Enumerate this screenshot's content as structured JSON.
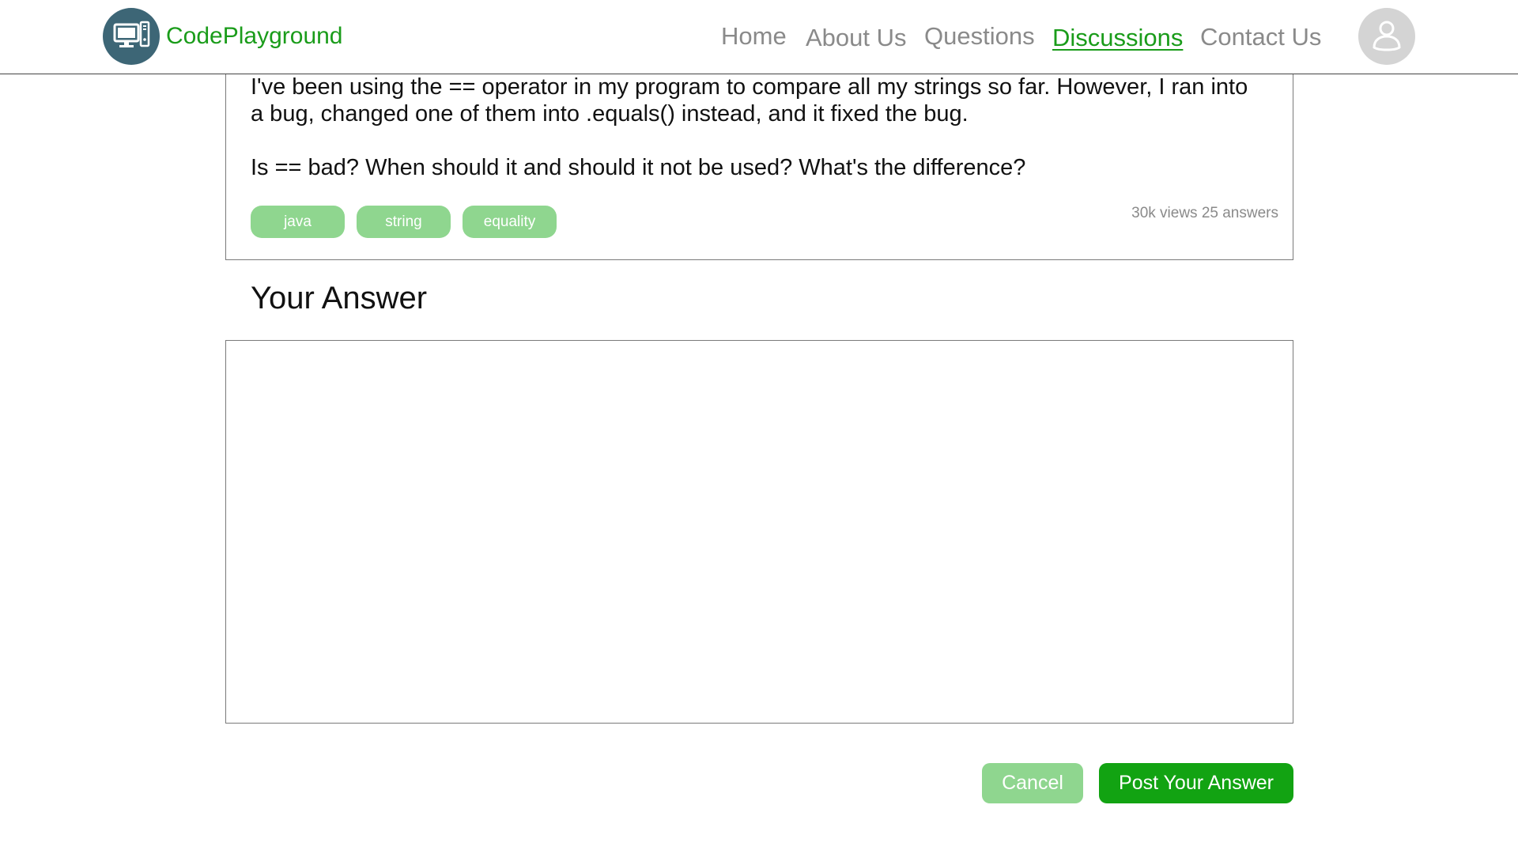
{
  "brand": {
    "name": "CodePlayground",
    "logo_icon": "computer-icon"
  },
  "nav": {
    "items": [
      {
        "label": "Home"
      },
      {
        "label": "About Us"
      },
      {
        "label": "Questions"
      },
      {
        "label": "Discussions"
      },
      {
        "label": "Contact Us"
      }
    ],
    "active": "Discussions",
    "profile_icon": "user-icon"
  },
  "question": {
    "body_1": "I've been using the == operator in my program to compare all my strings so far. However, I ran into a bug, changed one of them into .equals() instead, and it fixed the bug.",
    "body_2": "Is == bad? When should it and should it not be used? What's the difference?",
    "tags": [
      "java",
      "string",
      "equality"
    ],
    "stats": "30k views 25 answers"
  },
  "answer": {
    "heading": "Your Answer",
    "value": "",
    "cancel_label": "Cancel",
    "post_label": "Post Your Answer"
  },
  "colors": {
    "brand_green": "#1a9c1a",
    "tag_green": "#8fd68f",
    "post_green": "#12a312",
    "logo_bg": "#3d6676",
    "nav_gray": "#8a8a8a"
  }
}
